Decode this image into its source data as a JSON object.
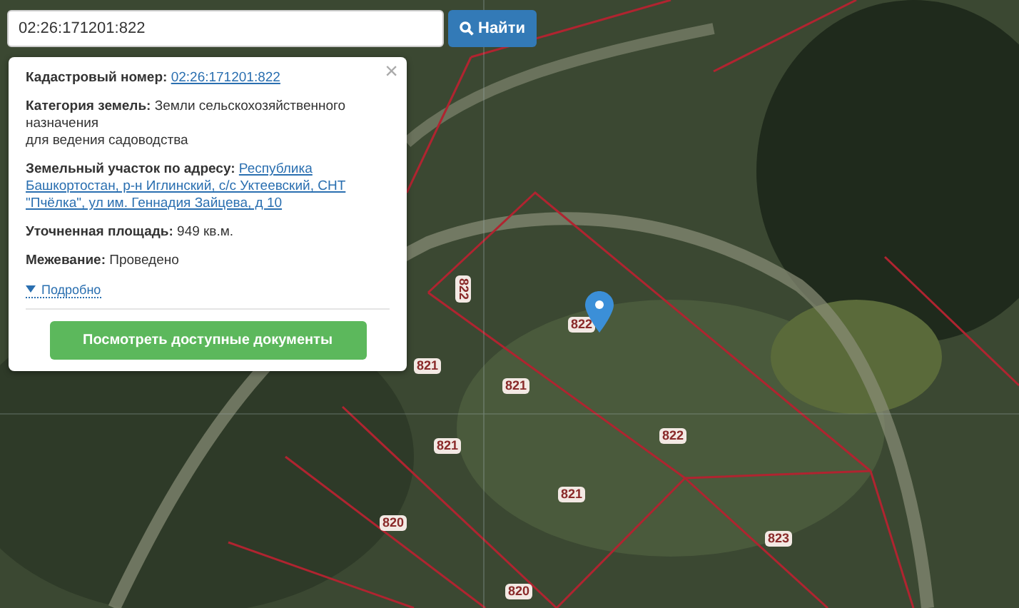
{
  "search": {
    "value": "02:26:171201:822",
    "button": "Найти"
  },
  "popup": {
    "close": "×",
    "fields": [
      {
        "kind": "link",
        "label": "Кадастровый номер:",
        "value": "02:26:171201:822"
      },
      {
        "kind": "text",
        "label": "Категория земель:",
        "value": "Земли сельскохозяйственного назначения",
        "note": "для ведения садоводства"
      },
      {
        "kind": "link",
        "label": "Земельный участок по адресу:",
        "value_lines": [
          "Республика",
          "Башкортостан, р-н Иглинский, с/с Уктеевский, СНТ",
          "\"Пчёлка\", ул им. Геннадия Зайцева, д 10"
        ]
      },
      {
        "kind": "text",
        "label": "Уточненная площадь:",
        "value": "949 кв.м."
      },
      {
        "kind": "text",
        "label": "Межевание:",
        "value": "Проведено"
      }
    ],
    "details": {
      "label": "Подробно",
      "expanded": false
    },
    "button": "Посмотреть доступные документы"
  },
  "map": {
    "labels": [
      "822",
      "822",
      "821",
      "821",
      "821",
      "822",
      "821",
      "820",
      "823",
      "820"
    ]
  }
}
